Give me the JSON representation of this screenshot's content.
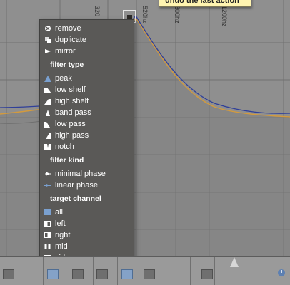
{
  "frequency_labels": [
    "320",
    "520hz",
    "800hz",
    "1200hz"
  ],
  "tooltip": {
    "text": "undo the last action"
  },
  "context_menu": {
    "actions": [
      {
        "label": "remove",
        "icon": "close-circle-icon"
      },
      {
        "label": "duplicate",
        "icon": "duplicate-icon"
      },
      {
        "label": "mirror",
        "icon": "mirror-icon"
      }
    ],
    "filter_type_title": "filter type",
    "filter_types": [
      {
        "label": "peak",
        "icon": "peak-icon"
      },
      {
        "label": "low shelf",
        "icon": "low-shelf-icon"
      },
      {
        "label": "high shelf",
        "icon": "high-shelf-icon"
      },
      {
        "label": "band pass",
        "icon": "band-pass-icon"
      },
      {
        "label": "low pass",
        "icon": "low-pass-icon"
      },
      {
        "label": "high pass",
        "icon": "high-pass-icon"
      },
      {
        "label": "notch",
        "icon": "notch-icon"
      }
    ],
    "filter_kind_title": "filter kind",
    "filter_kinds": [
      {
        "label": "minimal phase",
        "icon": "minimal-phase-icon"
      },
      {
        "label": "linear phase",
        "icon": "linear-phase-icon"
      }
    ],
    "target_channel_title": "target channel",
    "target_channels": [
      {
        "label": "all",
        "icon": "all-channel-icon"
      },
      {
        "label": "left",
        "icon": "left-channel-icon"
      },
      {
        "label": "right",
        "icon": "right-channel-icon"
      },
      {
        "label": "mid",
        "icon": "mid-channel-icon"
      },
      {
        "label": "side",
        "icon": "side-channel-icon"
      }
    ]
  },
  "colors": {
    "background": "#8f8f8f",
    "grid": "#6f6f6f",
    "menu_bg": "#5a5957",
    "orange_curve": "#d39a3d",
    "blue_curve": "#2f3f99",
    "tooltip_bg": "#fff4b0",
    "accent_blue": "#6f95c6"
  }
}
